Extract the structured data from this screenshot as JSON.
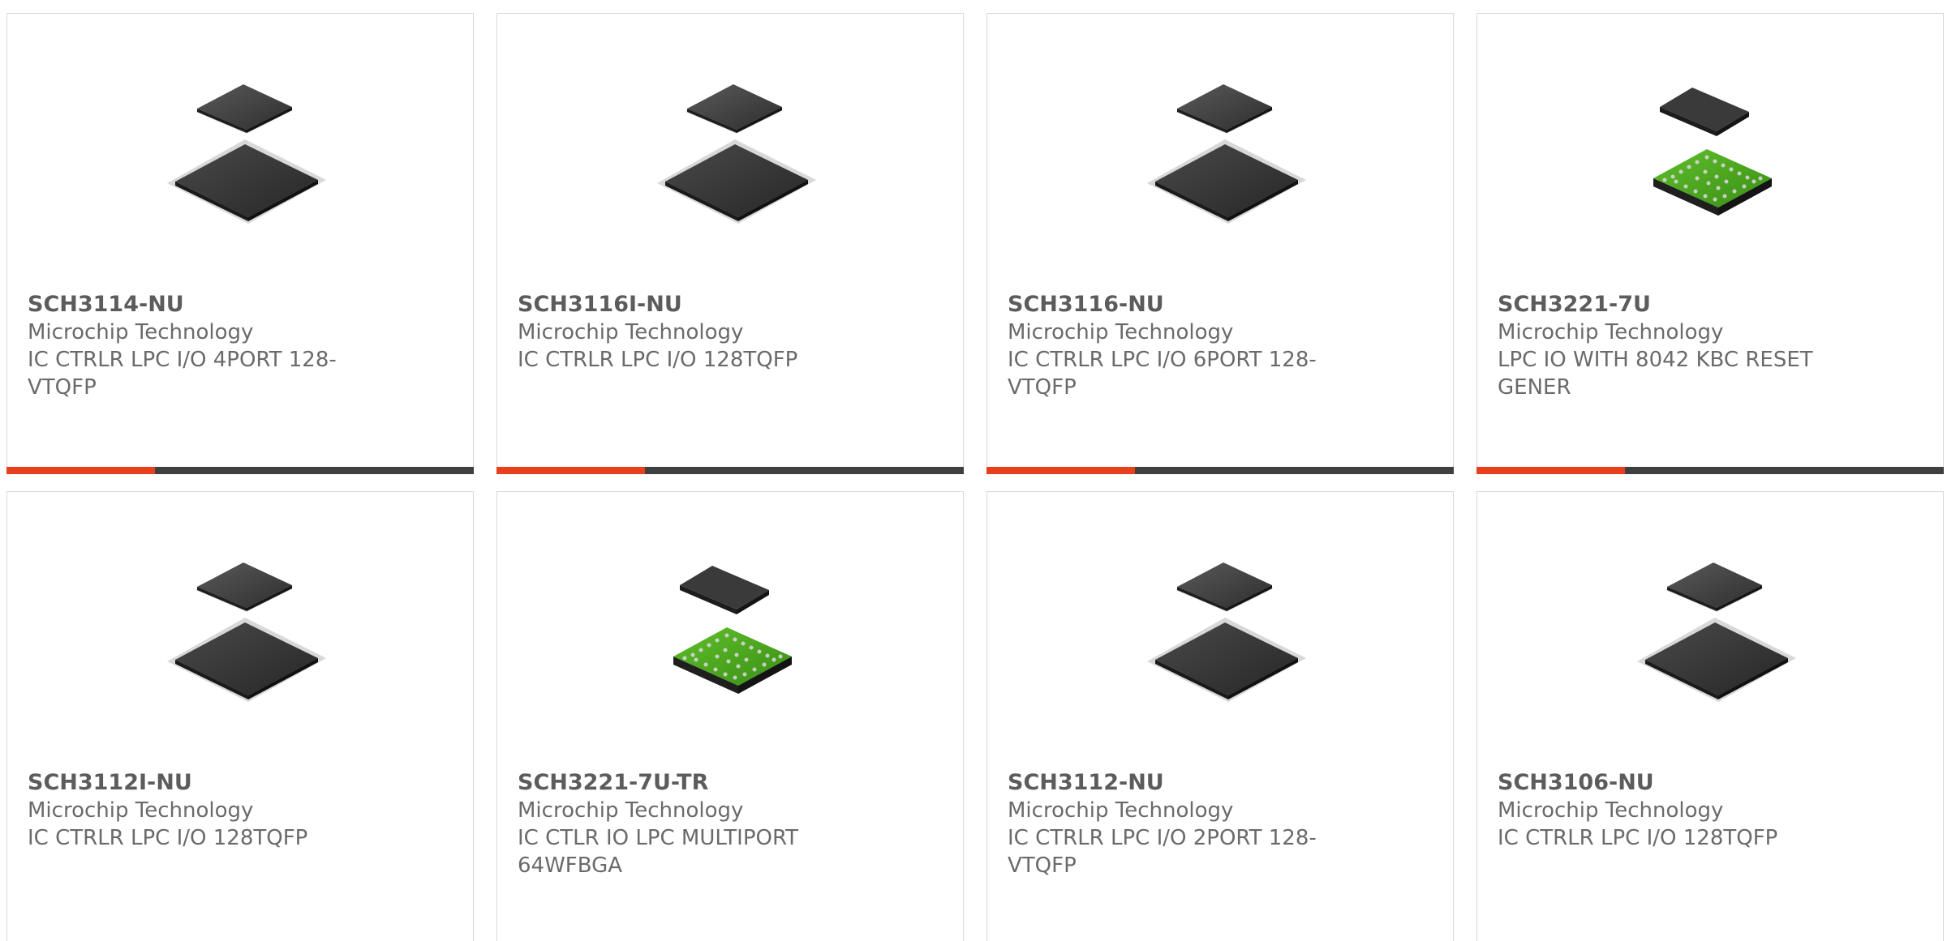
{
  "products": [
    {
      "part_number": "SCH3114-NU",
      "manufacturer": "Microchip Technology",
      "description": "IC CTRLR LPC I/O 4PORT 128-VTQFP",
      "package_icon": "qfp-chip-icon"
    },
    {
      "part_number": "SCH3116I-NU",
      "manufacturer": "Microchip Technology",
      "description": "IC CTRLR LPC I/O 128TQFP",
      "package_icon": "qfp-chip-icon"
    },
    {
      "part_number": "SCH3116-NU",
      "manufacturer": "Microchip Technology",
      "description": "IC CTRLR LPC I/O 6PORT 128-VTQFP",
      "package_icon": "qfp-chip-icon"
    },
    {
      "part_number": "SCH3221-7U",
      "manufacturer": "Microchip Technology",
      "description": "LPC IO WITH 8042 KBC RESET GENER",
      "package_icon": "bga-chip-icon"
    },
    {
      "part_number": "SCH3112I-NU",
      "manufacturer": "Microchip Technology",
      "description": "IC CTRLR LPC I/O 128TQFP",
      "package_icon": "qfp-chip-icon"
    },
    {
      "part_number": "SCH3221-7U-TR",
      "manufacturer": "Microchip Technology",
      "description": "IC CTLR IO LPC MULTIPORT 64WFBGA",
      "package_icon": "bga-chip-icon"
    },
    {
      "part_number": "SCH3112-NU",
      "manufacturer": "Microchip Technology",
      "description": "IC CTRLR LPC I/O 2PORT 128-VTQFP",
      "package_icon": "qfp-chip-icon"
    },
    {
      "part_number": "SCH3106-NU",
      "manufacturer": "Microchip Technology",
      "description": "IC CTRLR LPC I/O 128TQFP",
      "package_icon": "qfp-chip-icon"
    }
  ],
  "colors": {
    "accent": "#e8401c",
    "bar": "#3f3f3f",
    "border": "#d9d9d9",
    "text": "#6a6a6a"
  }
}
